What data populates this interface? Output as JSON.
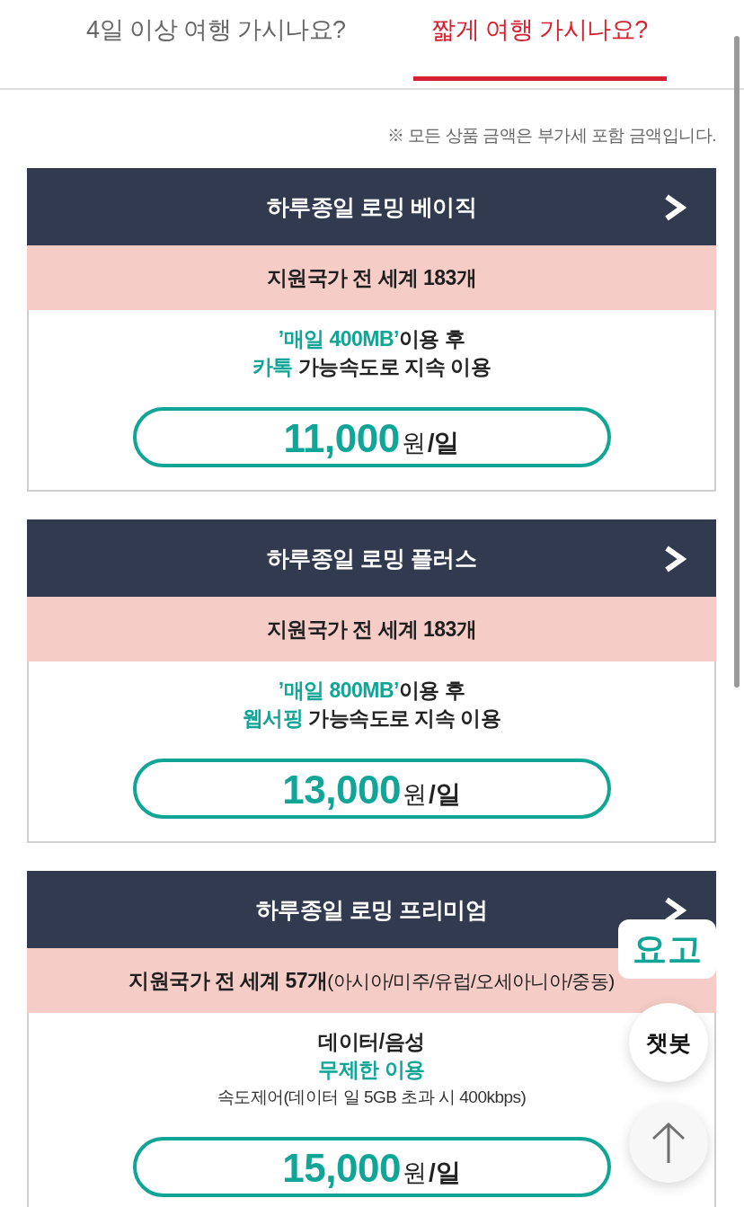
{
  "tabs": [
    {
      "label": "4일 이상 여행 가시나요?",
      "selected": false
    },
    {
      "label": "짧게 여행 가시나요?",
      "selected": true
    }
  ],
  "notice": "※ 모든 상품 금액은 부가세 포함 금액입니다.",
  "plans": [
    {
      "title": "하루종일 로밍 베이직",
      "coverage": "지원국가 전 세계 183개",
      "details": [
        {
          "kind": "main",
          "parts": [
            {
              "text": "’매일 400MB’",
              "highlight": true
            },
            {
              "text": "이용 후",
              "highlight": false
            }
          ]
        },
        {
          "kind": "main",
          "parts": [
            {
              "text": "카톡",
              "highlight": true
            },
            {
              "text": " 가능속도로 지속 이용",
              "highlight": false
            }
          ]
        }
      ],
      "price": {
        "amount": "11,000",
        "unit": "원",
        "per": "/일"
      }
    },
    {
      "title": "하루종일 로밍 플러스",
      "coverage": "지원국가 전 세계 183개",
      "details": [
        {
          "kind": "main",
          "parts": [
            {
              "text": "’매일 800MB’",
              "highlight": true
            },
            {
              "text": "이용 후",
              "highlight": false
            }
          ]
        },
        {
          "kind": "main",
          "parts": [
            {
              "text": "웹서핑",
              "highlight": true
            },
            {
              "text": " 가능속도로 지속 이용",
              "highlight": false
            }
          ]
        }
      ],
      "price": {
        "amount": "13,000",
        "unit": "원",
        "per": "/일"
      }
    },
    {
      "title": "하루종일 로밍 프리미엄",
      "coverage": "지원국가 전 세계 57개",
      "coverage_note": "(아시아/미주/유럽/오세아니아/중동)",
      "details": [
        {
          "kind": "main",
          "parts": [
            {
              "text": "데이터/음성",
              "highlight": false
            }
          ]
        },
        {
          "kind": "main",
          "parts": [
            {
              "text": "무제한 이용",
              "highlight": true
            }
          ]
        },
        {
          "kind": "note",
          "parts": [
            {
              "text": "속도제어(데이터 일 5GB 초과 시 400kbps)",
              "highlight": false
            }
          ]
        }
      ],
      "price": {
        "amount": "15,000",
        "unit": "원",
        "per": "/일"
      }
    }
  ],
  "floating": {
    "logo": "요고",
    "chatbot": "챗봇"
  }
}
